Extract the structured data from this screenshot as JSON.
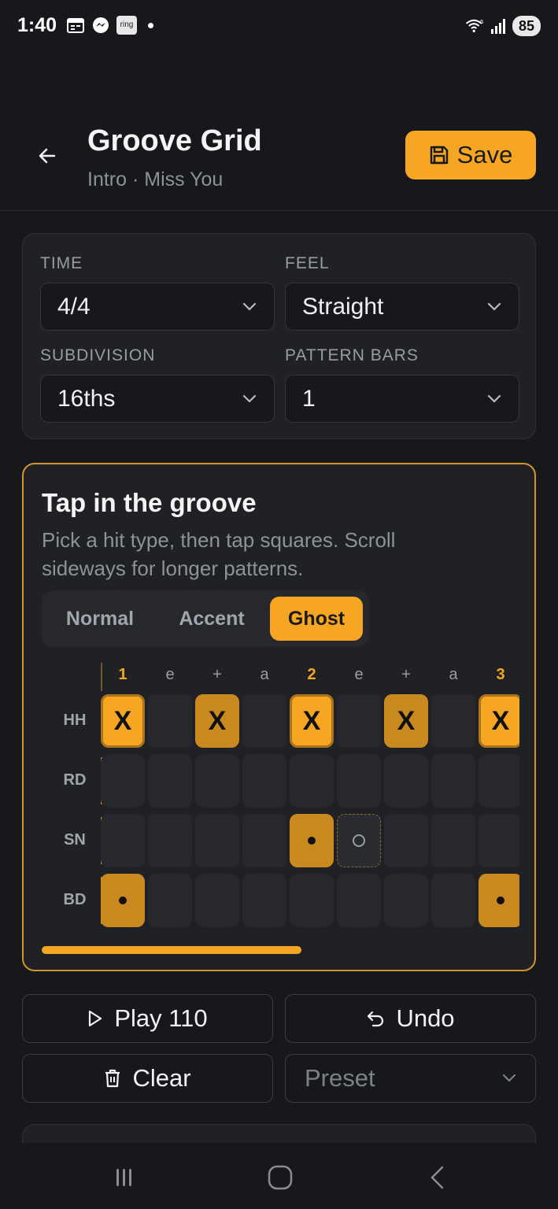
{
  "status_bar": {
    "time": "1:40",
    "ring_label": "ring",
    "signal_sup": "5",
    "battery": "85"
  },
  "header": {
    "title": "Groove Grid",
    "subtitle": "Intro · Miss You",
    "save_label": "Save"
  },
  "settings": {
    "time": {
      "label": "TIME",
      "value": "4/4"
    },
    "feel": {
      "label": "FEEL",
      "value": "Straight"
    },
    "subdivision": {
      "label": "SUBDIVISION",
      "value": "16ths"
    },
    "pattern_bars": {
      "label": "PATTERN BARS",
      "value": "1"
    }
  },
  "groove": {
    "title": "Tap in the groove",
    "description": "Pick a hit type, then tap squares. Scroll sideways for longer patterns.",
    "hit_types": [
      {
        "label": "Normal",
        "active": false
      },
      {
        "label": "Accent",
        "active": false
      },
      {
        "label": "Ghost",
        "active": true
      }
    ],
    "beats": [
      "1",
      "e",
      "+",
      "a",
      "2",
      "e",
      "+",
      "a",
      "3"
    ],
    "rows": [
      {
        "label": "HH",
        "cells": [
          "accent-x",
          "",
          "normal-x",
          "",
          "accent-x",
          "",
          "normal-x",
          "",
          "accent-x"
        ]
      },
      {
        "label": "RD",
        "cells": [
          "",
          "",
          "",
          "",
          "",
          "",
          "",
          "",
          ""
        ]
      },
      {
        "label": "SN",
        "cells": [
          "",
          "",
          "",
          "",
          "normal-dot",
          "ghost",
          "",
          "",
          ""
        ]
      },
      {
        "label": "BD",
        "cells": [
          "normal-dot",
          "",
          "",
          "",
          "",
          "",
          "",
          "",
          "normal-dot"
        ]
      }
    ],
    "hit_symbol": "X",
    "scroll_progress": 0.55
  },
  "actions": {
    "play_label": "Play 110",
    "undo_label": "Undo",
    "clear_label": "Clear",
    "preset_placeholder": "Preset"
  },
  "colors": {
    "accent": "#f6a623",
    "background": "#17181c",
    "card": "#1f2125"
  }
}
